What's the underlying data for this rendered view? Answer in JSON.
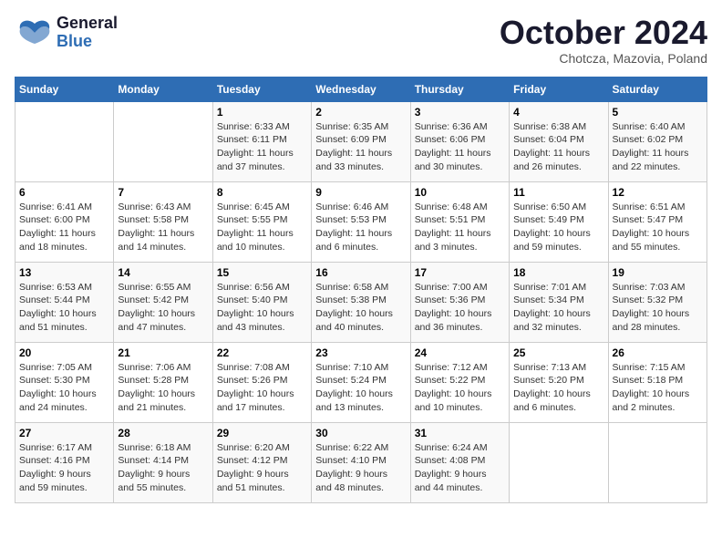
{
  "logo": {
    "general": "General",
    "blue": "Blue"
  },
  "title": "October 2024",
  "subtitle": "Chotcza, Mazovia, Poland",
  "days_header": [
    "Sunday",
    "Monday",
    "Tuesday",
    "Wednesday",
    "Thursday",
    "Friday",
    "Saturday"
  ],
  "weeks": [
    [
      {
        "num": "",
        "info": ""
      },
      {
        "num": "",
        "info": ""
      },
      {
        "num": "1",
        "info": "Sunrise: 6:33 AM\nSunset: 6:11 PM\nDaylight: 11 hours\nand 37 minutes."
      },
      {
        "num": "2",
        "info": "Sunrise: 6:35 AM\nSunset: 6:09 PM\nDaylight: 11 hours\nand 33 minutes."
      },
      {
        "num": "3",
        "info": "Sunrise: 6:36 AM\nSunset: 6:06 PM\nDaylight: 11 hours\nand 30 minutes."
      },
      {
        "num": "4",
        "info": "Sunrise: 6:38 AM\nSunset: 6:04 PM\nDaylight: 11 hours\nand 26 minutes."
      },
      {
        "num": "5",
        "info": "Sunrise: 6:40 AM\nSunset: 6:02 PM\nDaylight: 11 hours\nand 22 minutes."
      }
    ],
    [
      {
        "num": "6",
        "info": "Sunrise: 6:41 AM\nSunset: 6:00 PM\nDaylight: 11 hours\nand 18 minutes."
      },
      {
        "num": "7",
        "info": "Sunrise: 6:43 AM\nSunset: 5:58 PM\nDaylight: 11 hours\nand 14 minutes."
      },
      {
        "num": "8",
        "info": "Sunrise: 6:45 AM\nSunset: 5:55 PM\nDaylight: 11 hours\nand 10 minutes."
      },
      {
        "num": "9",
        "info": "Sunrise: 6:46 AM\nSunset: 5:53 PM\nDaylight: 11 hours\nand 6 minutes."
      },
      {
        "num": "10",
        "info": "Sunrise: 6:48 AM\nSunset: 5:51 PM\nDaylight: 11 hours\nand 3 minutes."
      },
      {
        "num": "11",
        "info": "Sunrise: 6:50 AM\nSunset: 5:49 PM\nDaylight: 10 hours\nand 59 minutes."
      },
      {
        "num": "12",
        "info": "Sunrise: 6:51 AM\nSunset: 5:47 PM\nDaylight: 10 hours\nand 55 minutes."
      }
    ],
    [
      {
        "num": "13",
        "info": "Sunrise: 6:53 AM\nSunset: 5:44 PM\nDaylight: 10 hours\nand 51 minutes."
      },
      {
        "num": "14",
        "info": "Sunrise: 6:55 AM\nSunset: 5:42 PM\nDaylight: 10 hours\nand 47 minutes."
      },
      {
        "num": "15",
        "info": "Sunrise: 6:56 AM\nSunset: 5:40 PM\nDaylight: 10 hours\nand 43 minutes."
      },
      {
        "num": "16",
        "info": "Sunrise: 6:58 AM\nSunset: 5:38 PM\nDaylight: 10 hours\nand 40 minutes."
      },
      {
        "num": "17",
        "info": "Sunrise: 7:00 AM\nSunset: 5:36 PM\nDaylight: 10 hours\nand 36 minutes."
      },
      {
        "num": "18",
        "info": "Sunrise: 7:01 AM\nSunset: 5:34 PM\nDaylight: 10 hours\nand 32 minutes."
      },
      {
        "num": "19",
        "info": "Sunrise: 7:03 AM\nSunset: 5:32 PM\nDaylight: 10 hours\nand 28 minutes."
      }
    ],
    [
      {
        "num": "20",
        "info": "Sunrise: 7:05 AM\nSunset: 5:30 PM\nDaylight: 10 hours\nand 24 minutes."
      },
      {
        "num": "21",
        "info": "Sunrise: 7:06 AM\nSunset: 5:28 PM\nDaylight: 10 hours\nand 21 minutes."
      },
      {
        "num": "22",
        "info": "Sunrise: 7:08 AM\nSunset: 5:26 PM\nDaylight: 10 hours\nand 17 minutes."
      },
      {
        "num": "23",
        "info": "Sunrise: 7:10 AM\nSunset: 5:24 PM\nDaylight: 10 hours\nand 13 minutes."
      },
      {
        "num": "24",
        "info": "Sunrise: 7:12 AM\nSunset: 5:22 PM\nDaylight: 10 hours\nand 10 minutes."
      },
      {
        "num": "25",
        "info": "Sunrise: 7:13 AM\nSunset: 5:20 PM\nDaylight: 10 hours\nand 6 minutes."
      },
      {
        "num": "26",
        "info": "Sunrise: 7:15 AM\nSunset: 5:18 PM\nDaylight: 10 hours\nand 2 minutes."
      }
    ],
    [
      {
        "num": "27",
        "info": "Sunrise: 6:17 AM\nSunset: 4:16 PM\nDaylight: 9 hours\nand 59 minutes."
      },
      {
        "num": "28",
        "info": "Sunrise: 6:18 AM\nSunset: 4:14 PM\nDaylight: 9 hours\nand 55 minutes."
      },
      {
        "num": "29",
        "info": "Sunrise: 6:20 AM\nSunset: 4:12 PM\nDaylight: 9 hours\nand 51 minutes."
      },
      {
        "num": "30",
        "info": "Sunrise: 6:22 AM\nSunset: 4:10 PM\nDaylight: 9 hours\nand 48 minutes."
      },
      {
        "num": "31",
        "info": "Sunrise: 6:24 AM\nSunset: 4:08 PM\nDaylight: 9 hours\nand 44 minutes."
      },
      {
        "num": "",
        "info": ""
      },
      {
        "num": "",
        "info": ""
      }
    ]
  ]
}
